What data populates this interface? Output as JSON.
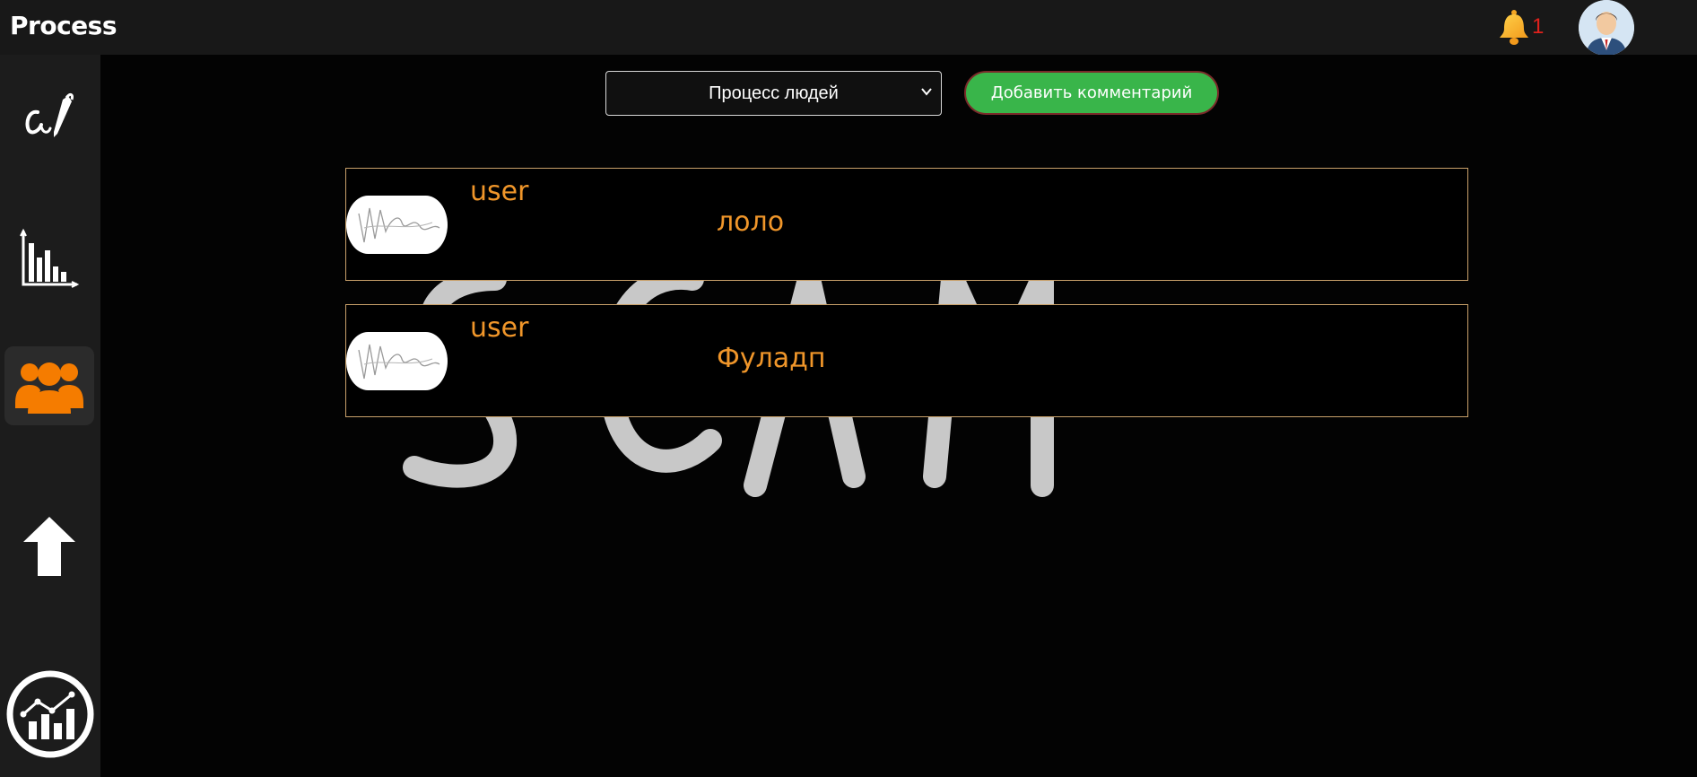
{
  "app": {
    "title": "Process"
  },
  "notifications": {
    "count": "1",
    "icon": "bell-icon"
  },
  "user": {
    "avatar_icon": "avatar-icon"
  },
  "sidebar": {
    "items": [
      {
        "icon": "signature-pen-icon"
      },
      {
        "icon": "bar-chart-icon"
      },
      {
        "icon": "people-icon",
        "active": true
      },
      {
        "icon": "upload-arrow-icon"
      },
      {
        "icon": "line-chart-icon"
      }
    ]
  },
  "toolbar": {
    "select_value": "Процесс людей",
    "add_comment_label": "Добавить комментарий"
  },
  "comments": [
    {
      "author": "user",
      "text": "лоло"
    },
    {
      "author": "user",
      "text": "Фуладп"
    }
  ],
  "colors": {
    "accent": "#f0962a",
    "button": "#39b54a",
    "active_sidebar_icon": "#f57c00",
    "notification": "#e0211c"
  }
}
